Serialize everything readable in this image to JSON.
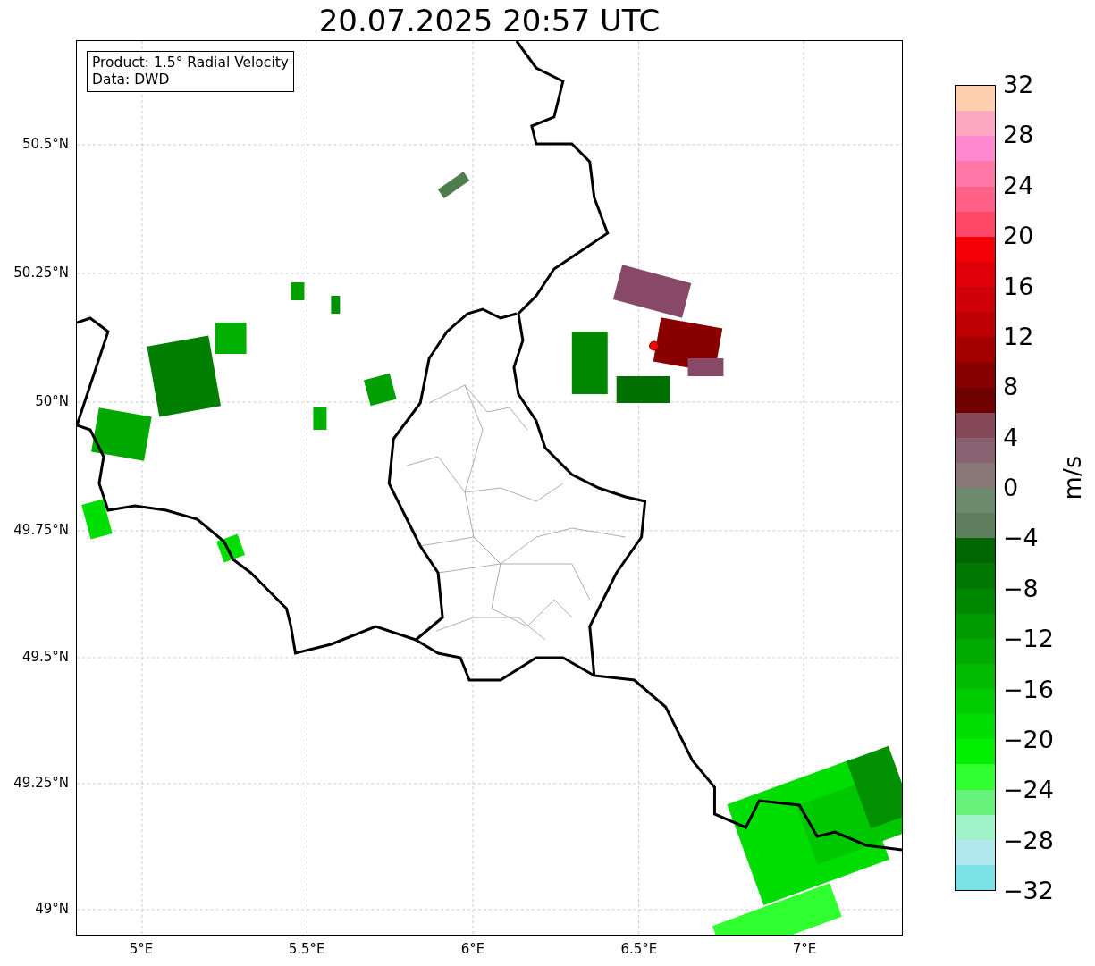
{
  "title": "20.07.2025 20:57 UTC",
  "info_box": {
    "lines": [
      "Product: 1.5° Radial Velocity",
      "Data: DWD"
    ]
  },
  "map": {
    "yticks": [
      "50.5°N",
      "50.25°N",
      "50°N",
      "49.75°N",
      "49.5°N",
      "49.25°N",
      "49°N"
    ],
    "xticks": [
      "5°E",
      "5.5°E",
      "6°E",
      "6.5°E",
      "7°E"
    ]
  },
  "colorbar": {
    "label": "m/s",
    "ticks": [
      "32",
      "28",
      "24",
      "20",
      "16",
      "12",
      "8",
      "4",
      "0",
      "−4",
      "−8",
      "−12",
      "−16",
      "−20",
      "−24",
      "−28",
      "−32"
    ],
    "bands": [
      {
        "color": "#ffd0b0"
      },
      {
        "color": "#ffa8c4"
      },
      {
        "color": "#ff88d0"
      },
      {
        "color": "#ff78a8"
      },
      {
        "color": "#ff6088"
      },
      {
        "color": "#ff4868"
      },
      {
        "color": "#f60008"
      },
      {
        "color": "#e00008"
      },
      {
        "color": "#d00008"
      },
      {
        "color": "#bc0004"
      },
      {
        "color": "#a40000"
      },
      {
        "color": "#880000"
      },
      {
        "color": "#6e0000"
      },
      {
        "color": "#844858"
      },
      {
        "color": "#886270"
      },
      {
        "color": "#8a7878"
      },
      {
        "color": "#6c8a6c"
      },
      {
        "color": "#5e7e5e"
      },
      {
        "color": "#006600"
      },
      {
        "color": "#007700"
      },
      {
        "color": "#008800"
      },
      {
        "color": "#009a00"
      },
      {
        "color": "#00aa00"
      },
      {
        "color": "#00bb00"
      },
      {
        "color": "#00cc00"
      },
      {
        "color": "#00dd00"
      },
      {
        "color": "#00f000"
      },
      {
        "color": "#30ff30"
      },
      {
        "color": "#66f27a"
      },
      {
        "color": "#a0f2c8"
      },
      {
        "color": "#b0e8ee"
      },
      {
        "color": "#7ae3e8"
      }
    ]
  }
}
